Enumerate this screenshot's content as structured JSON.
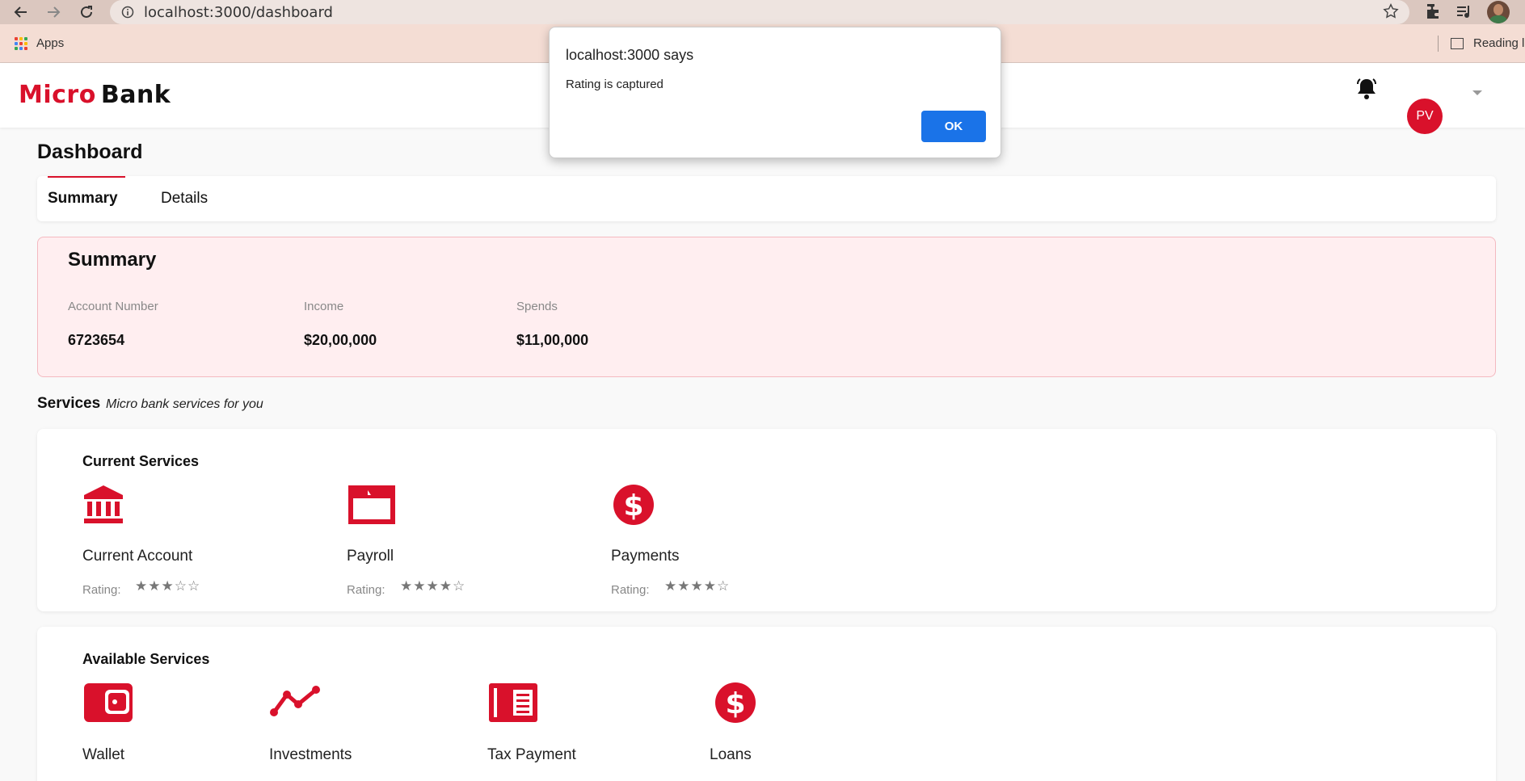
{
  "browser": {
    "url": "localhost:3000/dashboard",
    "bookmarks": {
      "apps_label": "Apps",
      "reading_label": "Reading l"
    }
  },
  "header": {
    "logo_micro": "Micro",
    "logo_bank": "Bank",
    "avatar_initials": "PV"
  },
  "page": {
    "title": "Dashboard",
    "tabs": [
      {
        "label": "Summary",
        "active": true
      },
      {
        "label": "Details",
        "active": false
      }
    ]
  },
  "summary": {
    "title": "Summary",
    "account_label": "Account Number",
    "account_value": "6723654",
    "income_label": "Income",
    "income_value": "$20,00,000",
    "spends_label": "Spends",
    "spends_value": "$11,00,000"
  },
  "services": {
    "heading": "Services",
    "subheading": "Micro bank services for you",
    "current": {
      "title": "Current Services",
      "rating_label": "Rating:",
      "items": [
        {
          "name": "Current Account",
          "icon": "bank-icon",
          "rating": 3
        },
        {
          "name": "Payroll",
          "icon": "folder-icon",
          "rating": 4
        },
        {
          "name": "Payments",
          "icon": "dollar-icon",
          "rating": 4
        }
      ]
    },
    "available": {
      "title": "Available Services",
      "items": [
        {
          "name": "Wallet",
          "icon": "wallet-icon"
        },
        {
          "name": "Investments",
          "icon": "trend-icon"
        },
        {
          "name": "Tax Payment",
          "icon": "document-icon"
        },
        {
          "name": "Loans",
          "icon": "dollar-icon"
        }
      ]
    }
  },
  "dialog": {
    "title": "localhost:3000 says",
    "message": "Rating is captured",
    "ok_label": "OK"
  },
  "colors": {
    "brand": "#d9112b",
    "dialog_button": "#1a73e8"
  }
}
